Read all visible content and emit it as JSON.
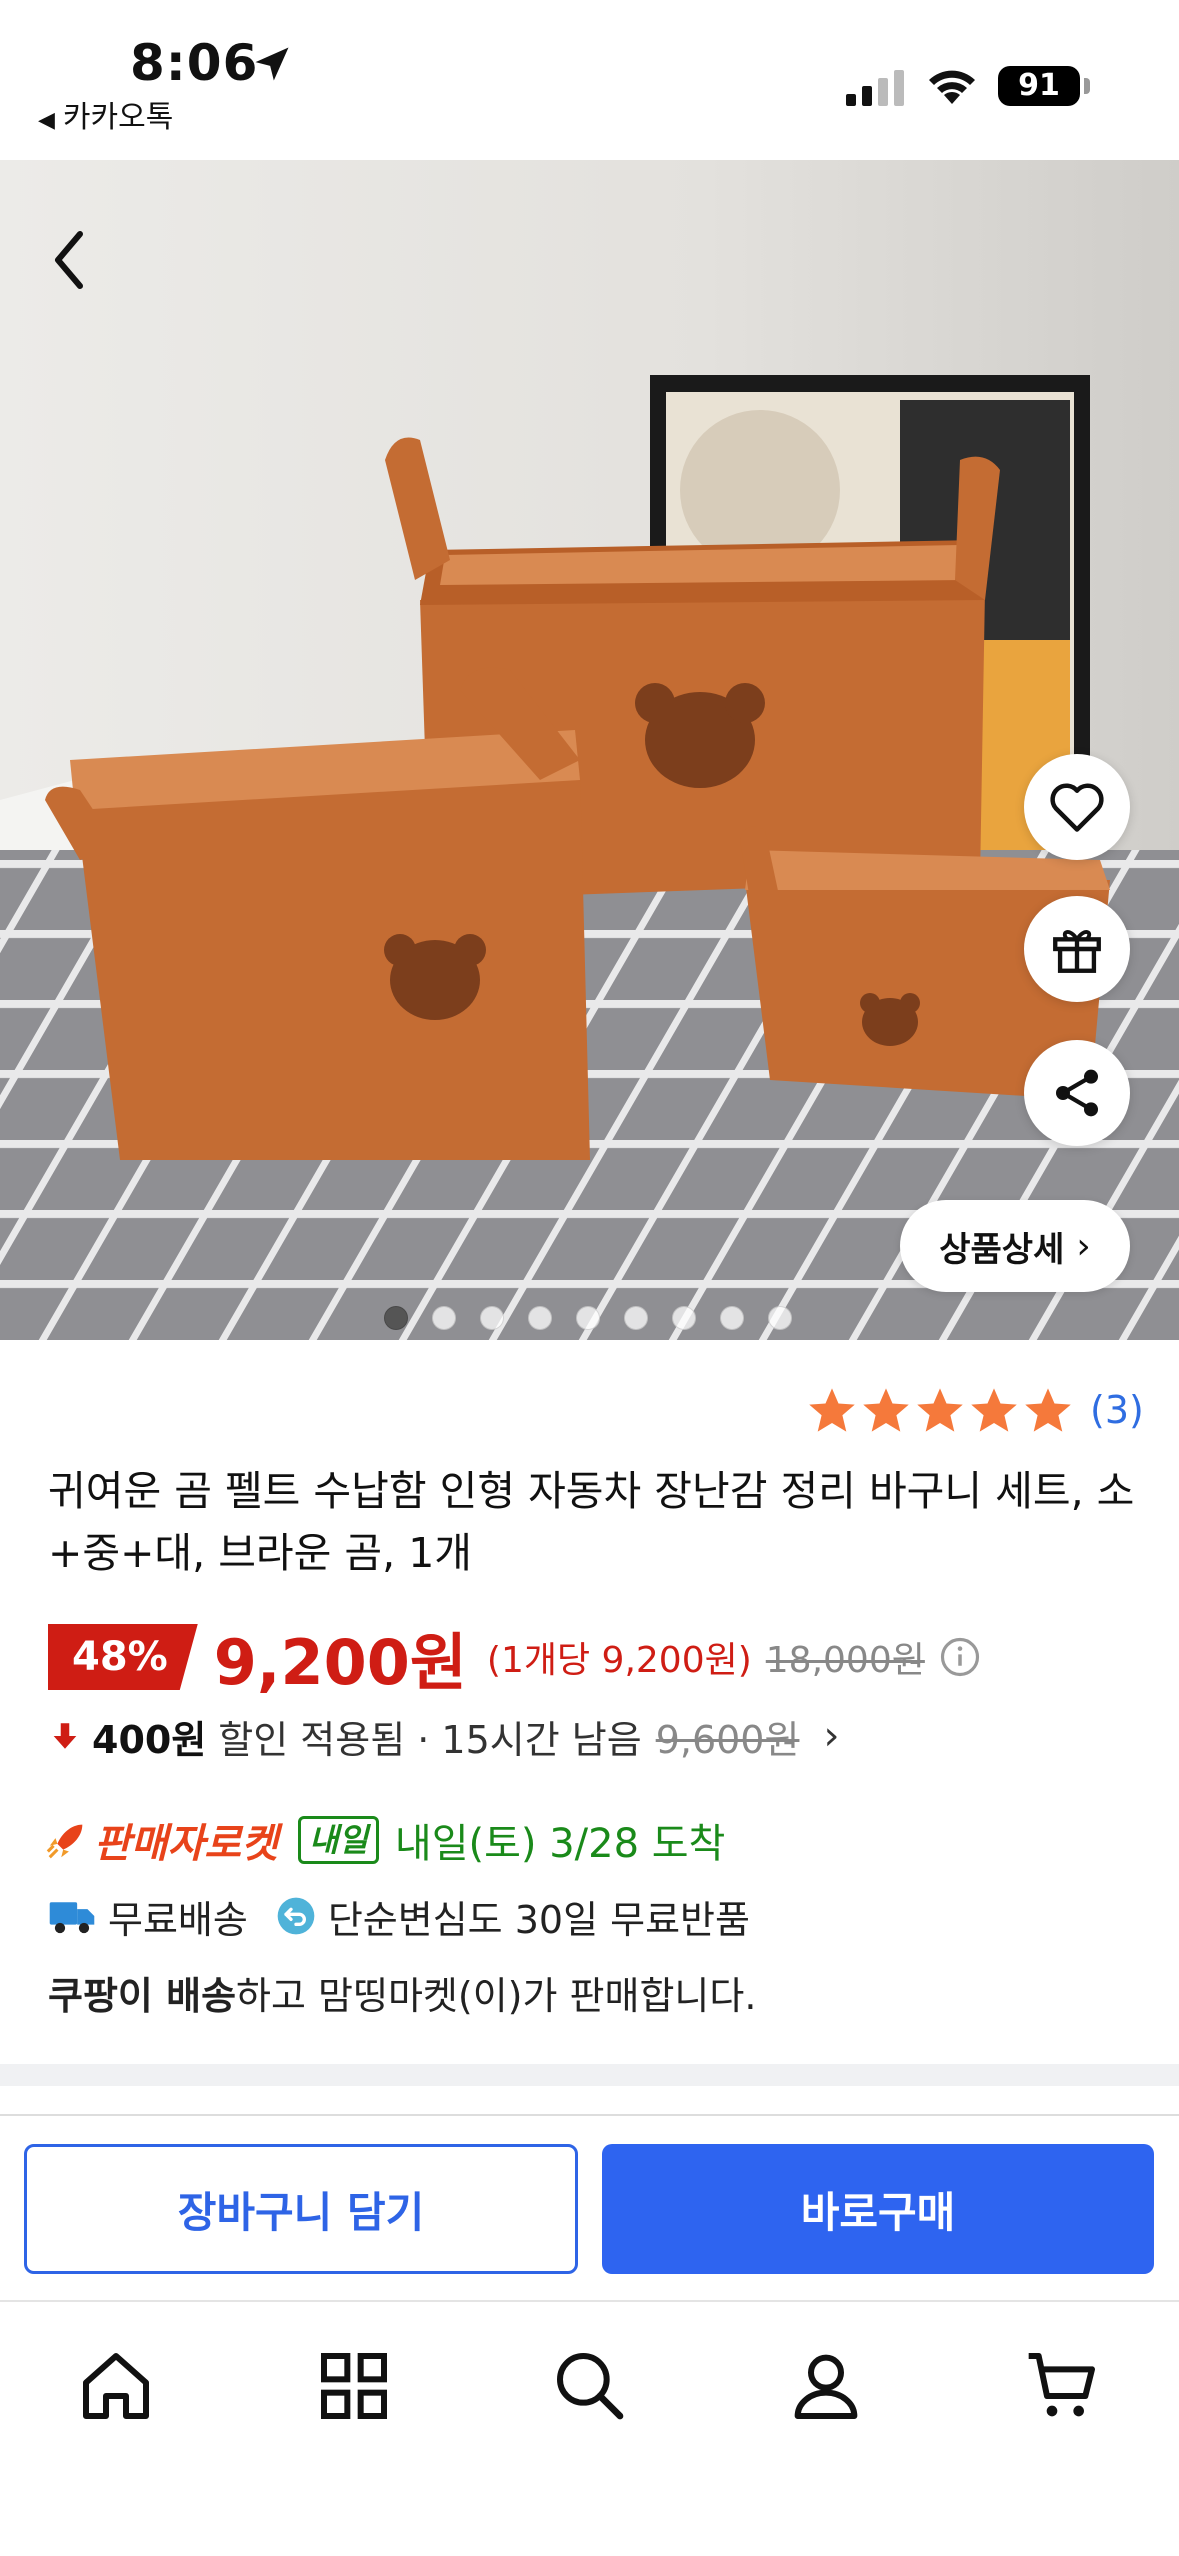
{
  "status_bar": {
    "time": "8:06",
    "back_app": "카카오톡",
    "battery": "91"
  },
  "hero": {
    "detail_button": "상품상세",
    "dots_count": 9,
    "active_dot": 0
  },
  "product": {
    "rating_stars": 5,
    "review_count": "(3)",
    "title": "귀여운 곰 펠트 수납함 인형 자동차 장난감 정리 바구니 세트, 소+중+대, 브라운 곰, 1개",
    "discount": "48%",
    "price": "9,200원",
    "unit_price": "(1개당 9,200원)",
    "original_price": "18,000원",
    "coupon_amount": "400원",
    "coupon_text": "할인 적용됨 · 15시간 남음",
    "coupon_original": "9,600원",
    "rocket_label": "판매자로켓",
    "tomorrow_badge": "내일",
    "arrival": "내일(토) 3/28 도착",
    "free_shipping": "무료배송",
    "free_return": "단순변심도 30일 무료반품",
    "seller_bold": "쿠팡이 배송",
    "seller_rest": "하고 맘띵마켓(이)가 판매합니다."
  },
  "actions": {
    "cart": "장바구니 담기",
    "buy": "바로구매"
  },
  "colors": {
    "accent_red": "#cf1d14",
    "primary_blue": "#2e64f0",
    "star": "#f5793b",
    "green": "#1a8a1a"
  },
  "tabs": [
    "home-icon",
    "category-icon",
    "search-icon",
    "profile-icon",
    "cart-icon"
  ]
}
